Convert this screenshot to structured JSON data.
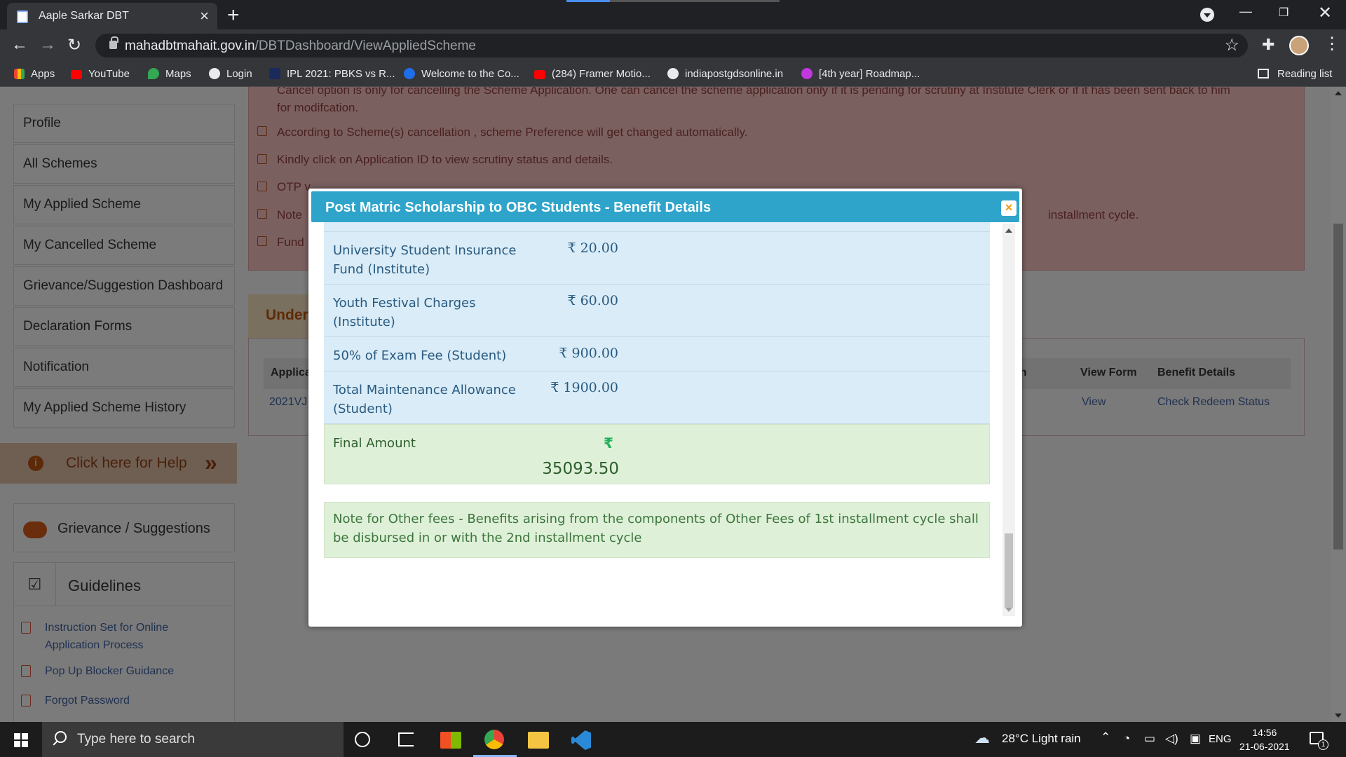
{
  "browser": {
    "tab_title": "Aaple Sarkar DBT",
    "url_host": "mahadbtmahait.gov.in",
    "url_path": "/DBTDashboard/ViewAppliedScheme",
    "bookmarks": [
      {
        "label": "Apps",
        "icon": "apps-grid-icon"
      },
      {
        "label": "YouTube",
        "icon": "youtube-icon"
      },
      {
        "label": "Maps",
        "icon": "maps-pin-icon"
      },
      {
        "label": "Login",
        "icon": "globe-icon"
      },
      {
        "label": "IPL 2021: PBKS vs R...",
        "icon": "sports-icon"
      },
      {
        "label": "Welcome to the Co...",
        "icon": "c-logo-icon"
      },
      {
        "label": "(284) Framer Motio...",
        "icon": "youtube-icon"
      },
      {
        "label": "indiapostgdsonline.in",
        "icon": "globe-icon"
      },
      {
        "label": "[4th year] Roadmap...",
        "icon": "m-logo-icon"
      }
    ],
    "reading_list": "Reading list"
  },
  "sidebar": {
    "items": [
      {
        "label": "Profile"
      },
      {
        "label": "All Schemes"
      },
      {
        "label": "My Applied Scheme"
      },
      {
        "label": "My Cancelled Scheme"
      },
      {
        "label": "Grievance/Suggestion Dashboard"
      },
      {
        "label": "Declaration Forms"
      },
      {
        "label": "Notification"
      },
      {
        "label": "My Applied Scheme History"
      }
    ],
    "help": "Click here for Help",
    "grievance": "Grievance / Suggestions",
    "guidelines_title": "Guidelines",
    "guidelines": [
      {
        "line1": "Instruction Set for Online",
        "line2": "Application Process"
      },
      {
        "line1": "Pop Up Blocker Guidance",
        "line2": ""
      },
      {
        "line1": "Forgot Password",
        "line2": ""
      }
    ]
  },
  "notes": {
    "n1a": "Cancel option is only for cancelling the Scheme Application. One can cancel the scheme application only if it is pending for scrutiny at Institute Clerk or if it has been sent back to him",
    "n1b": "for modifcation.",
    "n2": "According to Scheme(s) cancellation , scheme Preference will get changed automatically.",
    "n3": "Kindly click on Application ID to view scrutiny status and details.",
    "n4": "OTP v",
    "n5": "Note",
    "n5_tail": "installment cycle.",
    "n6": "Fund"
  },
  "under_tab": "Under",
  "table": {
    "headers": {
      "app": "Applica",
      "on": "on",
      "view_form": "View Form",
      "benefit": "Benefit Details"
    },
    "row": {
      "app_id": "2021VJ",
      "view": "View",
      "redeem": "Check Redeem Status"
    }
  },
  "modal": {
    "title": "Post Matric Scholarship to OBC Students - Benefit Details",
    "close": "×",
    "currency": "₹",
    "rows": [
      {
        "label": "University Student Insurance Fund (Institute)",
        "amount": "20.00"
      },
      {
        "label": "Youth Festival Charges (Institute)",
        "amount": "60.00"
      },
      {
        "label": "50% of Exam Fee (Student)",
        "amount": "900.00"
      },
      {
        "label": "Total Maintenance Allowance (Student)",
        "amount": "1900.00"
      }
    ],
    "final_label": "Final Amount",
    "final_amount": "35093.50",
    "fee_note": "Note for Other fees - Benefits arising from the components of Other Fees of 1st installment cycle shall be disbursed in or with the 2nd installment cycle"
  },
  "taskbar": {
    "search_placeholder": "Type here to search",
    "weather": "28°C  Light rain",
    "lang": "ENG",
    "time": "14:56",
    "date": "21-06-2021",
    "notif_count": "1"
  },
  "colors": {
    "modal_header": "#2fa4cb",
    "row_bg": "#d9ecf7",
    "final_bg": "#dff0d8",
    "rupee_green": "#1fb25a"
  }
}
